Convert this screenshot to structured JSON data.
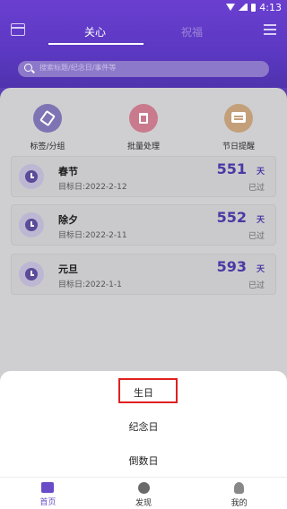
{
  "status_bar": {
    "time": "4:13"
  },
  "top_bar": {
    "tabs": [
      {
        "label": "关心",
        "active": true
      },
      {
        "label": "祝福",
        "active": false
      }
    ]
  },
  "search": {
    "placeholder": "搜索标题/纪念日/事件等"
  },
  "quick_actions": [
    {
      "label": "标签/分组",
      "icon": "tag-icon",
      "color": "#7f74b3"
    },
    {
      "label": "批量处理",
      "icon": "trash-icon",
      "color": "#c97a8d"
    },
    {
      "label": "节日提醒",
      "icon": "message-icon",
      "color": "#c3a07a"
    }
  ],
  "events": [
    {
      "title": "春节",
      "target": "目标日:2022-2-12",
      "days": "551",
      "unit": "天",
      "status": "已过"
    },
    {
      "title": "除夕",
      "target": "目标日:2022-2-11",
      "days": "552",
      "unit": "天",
      "status": "已过"
    },
    {
      "title": "元旦",
      "target": "目标日:2022-1-1",
      "days": "593",
      "unit": "天",
      "status": "已过"
    }
  ],
  "sheet": {
    "options": [
      {
        "label": "生日",
        "highlighted": true
      },
      {
        "label": "纪念日",
        "highlighted": false
      },
      {
        "label": "倒数日",
        "highlighted": false
      }
    ]
  },
  "bottom_nav": [
    {
      "label": "首页",
      "active": true,
      "icon": "calendar-icon"
    },
    {
      "label": "发现",
      "active": false,
      "icon": "planet-icon"
    },
    {
      "label": "我的",
      "active": false,
      "icon": "person-icon"
    }
  ],
  "colors": {
    "brand": "#5b38c2",
    "accent": "#4a39a4",
    "highlight": "#e02020"
  }
}
